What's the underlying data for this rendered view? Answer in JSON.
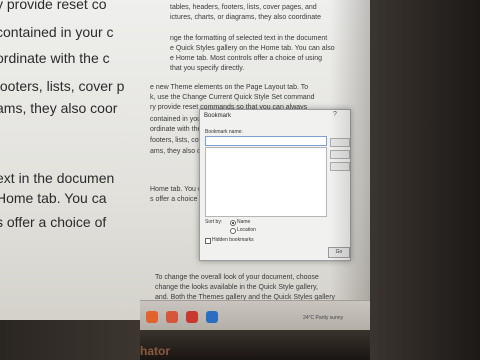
{
  "document": {
    "lines_big": [
      "y provide reset co",
      "contained in your c",
      "ordinate with the c",
      "footers, lists, cover p",
      "ams, they also coor",
      "ext in the documen",
      "Home tab. You ca",
      "s offer a choice of"
    ],
    "lines_small": [
      "tables, headers, footers, lists, cover pages, and",
      "ictures, charts, or diagrams, they also coordinate",
      "nge the formatting of selected text in the document",
      "e Quick Styles gallery on the Home tab. You can also",
      "e Home tab. Most controls offer a choice of using",
      "that you specify directly.",
      "e new Theme elements on the Page Layout tab. To",
      "k, use the Change Current Quick Style Set command",
      "ry provide reset commands so that you can always",
      "contained in your c",
      "ordinate with the c",
      "footers, lists, cover p",
      "ams, they also coord",
      "Home tab. You can a",
      "s offer a choice of u",
      "To change the overall look of your document, choose",
      "change the looks available in the Quick Style gallery,",
      "and. Both the Themes gallery and the Quick Styles gallery"
    ]
  },
  "dialog": {
    "title": "Bookmark",
    "help": "?",
    "name_label": "Bookmark name:",
    "name_value": "",
    "sort_label": "Sort by:",
    "sort_options": [
      "Name",
      "Location"
    ],
    "sort_selected": "Name",
    "hidden_label": "Hidden bookmarks",
    "ok_label": "Go"
  },
  "taskbar": {
    "status_text": "24°C  Partly sunny"
  },
  "brand": "hator"
}
